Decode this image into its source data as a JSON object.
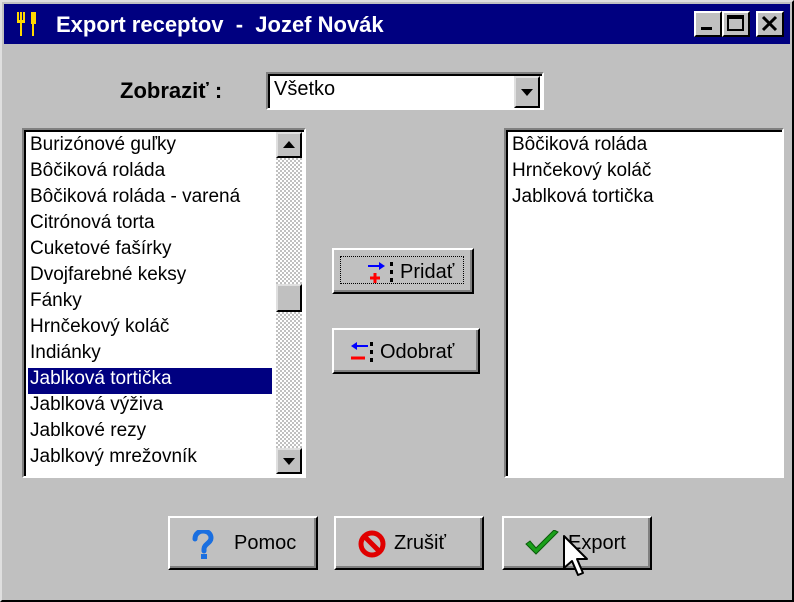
{
  "window": {
    "title": "Export receptov  -  Jozef Novák",
    "controls": [
      "minimize",
      "maximize",
      "close"
    ]
  },
  "filter": {
    "label": "Zobraziť :",
    "selected": "Všetko"
  },
  "source_list": {
    "items": [
      "Burizónové guľky",
      "Bôčiková roláda",
      "Bôčiková roláda - varená",
      "Citrónová torta",
      "Cuketové fašírky",
      "Dvojfarebné keksy",
      "Fánky",
      "Hrnčekový koláč",
      "Indiánky",
      "Jablková tortička",
      "Jablková výživa",
      "Jablkové rezy",
      "Jablkový mrežovník"
    ],
    "selected_index": 9
  },
  "target_list": {
    "items": [
      "Bôčiková roláda",
      "Hrnčekový koláč",
      "Jablková tortička"
    ]
  },
  "buttons": {
    "add": "Pridať",
    "remove": "Odobrať",
    "help": "Pomoc",
    "cancel": "Zrušiť",
    "export": "Export"
  },
  "colors": {
    "titlebar": "#000080",
    "face": "#c0c0c0",
    "selection": "#000080"
  },
  "icons": {
    "app": "fork-knife-icon",
    "add": "add-arrow-icon",
    "remove": "remove-arrow-icon",
    "help": "question-icon",
    "cancel": "no-sign-icon",
    "export": "checkmark-icon",
    "cursor": "mouse-pointer-icon"
  }
}
